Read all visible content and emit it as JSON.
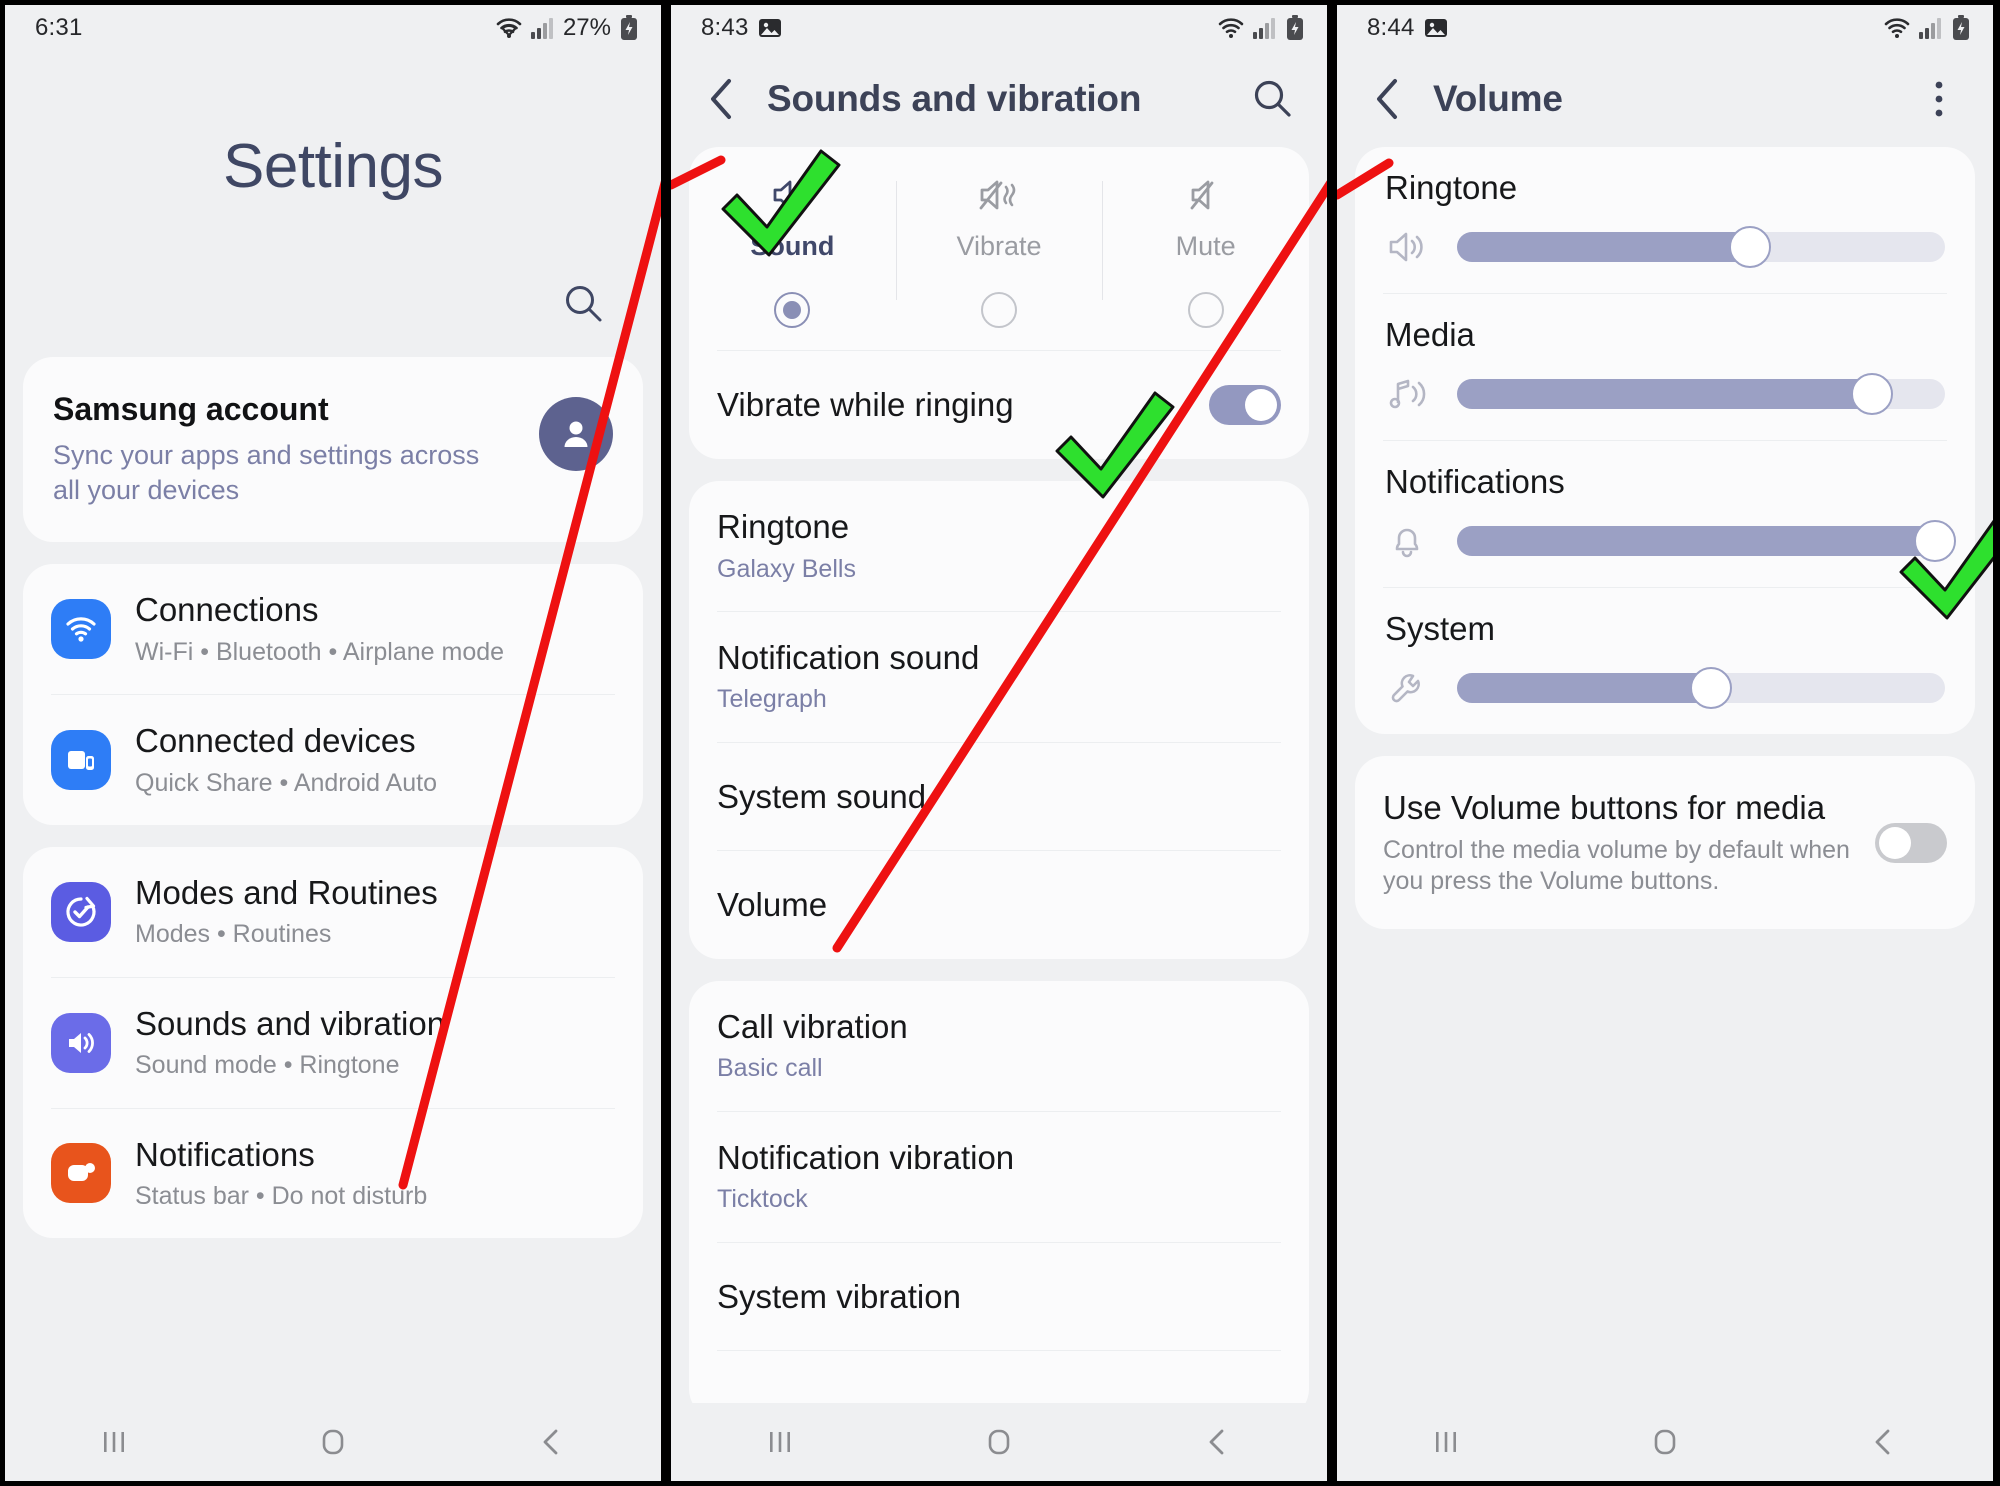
{
  "panels": [
    {
      "id": "settings-home",
      "status": {
        "time": "6:31",
        "battery_percent": "27%",
        "icons": [
          "wifi-icon",
          "signal-icon",
          "battery-charging-icon"
        ]
      },
      "header_title": "Settings",
      "account": {
        "title": "Samsung account",
        "subtitle": "Sync your apps and settings across all your devices"
      },
      "groups": [
        {
          "items": [
            {
              "title": "Connections",
              "subtitle": "Wi-Fi  •  Bluetooth  •  Airplane mode",
              "icon": "wifi-icon",
              "tint": "blue"
            },
            {
              "title": "Connected devices",
              "subtitle": "Quick Share  •  Android Auto",
              "icon": "devices-icon",
              "tint": "blue"
            }
          ]
        },
        {
          "items": [
            {
              "title": "Modes and Routines",
              "subtitle": "Modes  •  Routines",
              "icon": "modes-icon",
              "tint": "indigo"
            },
            {
              "title": "Sounds and vibration",
              "subtitle": "Sound mode  •  Ringtone",
              "icon": "sound-icon",
              "tint": "violet"
            },
            {
              "title": "Notifications",
              "subtitle": "Status bar  •  Do not disturb",
              "icon": "notifications-icon",
              "tint": "orange"
            }
          ]
        }
      ]
    },
    {
      "id": "sounds-and-vibration",
      "status": {
        "time": "8:43",
        "battery_percent": "",
        "icons": [
          "image-icon",
          "wifi-icon",
          "signal-icon",
          "battery-charging-icon"
        ]
      },
      "appbar": {
        "title": "Sounds and vibration",
        "back": "back-chevron-icon",
        "action": "search-icon"
      },
      "sound_modes": [
        {
          "label": "Sound",
          "icon": "volume-on-icon",
          "selected": true
        },
        {
          "label": "Vibrate",
          "icon": "vibrate-icon",
          "selected": false
        },
        {
          "label": "Mute",
          "icon": "mute-icon",
          "selected": false
        }
      ],
      "vibrate_while_ringing": {
        "label": "Vibrate while ringing",
        "enabled": true
      },
      "groups": [
        {
          "items": [
            {
              "title": "Ringtone",
              "subtitle": "Galaxy Bells"
            },
            {
              "title": "Notification sound",
              "subtitle": "Telegraph"
            },
            {
              "title": "System sound",
              "subtitle": ""
            },
            {
              "title": "Volume",
              "subtitle": ""
            }
          ]
        },
        {
          "items": [
            {
              "title": "Call vibration",
              "subtitle": "Basic call"
            },
            {
              "title": "Notification vibration",
              "subtitle": "Ticktock"
            },
            {
              "title": "System vibration",
              "subtitle": ""
            }
          ]
        }
      ]
    },
    {
      "id": "volume",
      "status": {
        "time": "8:44",
        "battery_percent": "",
        "icons": [
          "image-icon",
          "wifi-icon",
          "signal-icon",
          "battery-charging-icon"
        ]
      },
      "appbar": {
        "title": "Volume",
        "back": "back-chevron-icon",
        "action": "more-options-icon"
      },
      "sliders": [
        {
          "label": "Ringtone",
          "icon": "volume-on-icon",
          "value": 60
        },
        {
          "label": "Media",
          "icon": "media-note-icon",
          "value": 85
        },
        {
          "label": "Notifications",
          "icon": "bell-icon",
          "value": 98
        },
        {
          "label": "System",
          "icon": "wrench-icon",
          "value": 52
        }
      ],
      "volume_buttons": {
        "title": "Use Volume buttons for media",
        "subtitle": "Control the media volume by default when you press the Volume buttons.",
        "enabled": false
      }
    }
  ],
  "navbar": {
    "recents": "recents-icon",
    "home": "home-icon",
    "back": "back-icon"
  },
  "annotations": {
    "arrow_color": "#ee1111",
    "check_color": "#2ee02e",
    "arrows": [
      {
        "name": "arrow-to-sounds-and-vibration"
      },
      {
        "name": "arrow-to-volume"
      }
    ],
    "checks": [
      {
        "name": "check-sound-mode"
      },
      {
        "name": "check-vibrate-while-ringing"
      },
      {
        "name": "check-notifications-volume"
      }
    ]
  }
}
